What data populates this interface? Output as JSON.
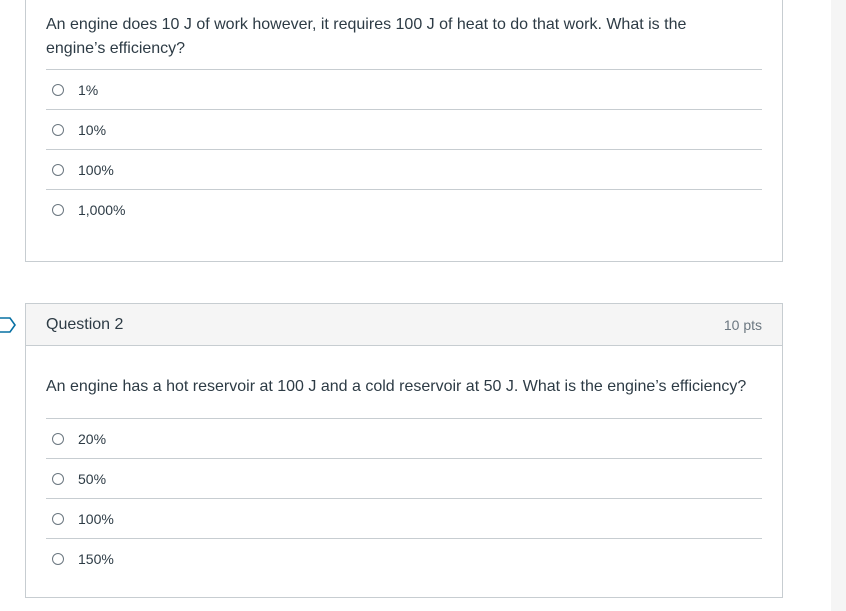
{
  "questions": [
    {
      "title": "",
      "points": "",
      "text": "An engine does 10 J of work however, it requires 100 J of heat to do that work. What is the engine’s efficiency?",
      "answers": [
        "1%",
        "10%",
        "100%",
        "1,000%"
      ]
    },
    {
      "title": "Question 2",
      "points": "10 pts",
      "text": "An engine has a hot reservoir at 100 J and a cold reservoir at 50 J. What is the engine’s efficiency?",
      "answers": [
        "20%",
        "50%",
        "100%",
        "150%"
      ]
    }
  ],
  "icons": {
    "flag": "flag-question-icon"
  },
  "colors": {
    "border": "#c7cdd1",
    "header_bg": "#f5f5f5",
    "text": "#2d3b45",
    "muted": "#6b7780",
    "flag": "#0770a3"
  }
}
